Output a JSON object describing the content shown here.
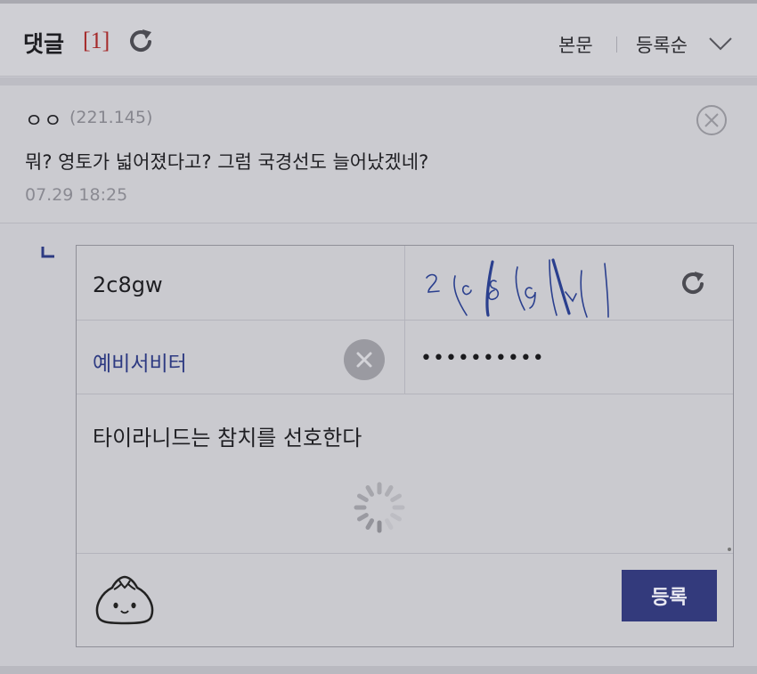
{
  "header": {
    "title": "댓글",
    "count": "[1]",
    "sort_body": "본문",
    "sort_order": "등록순"
  },
  "comment": {
    "author": "ㅇㅇ",
    "ip": "(221.145)",
    "text": "뭐? 영토가 넓어졌다고? 그럼 국경선도 늘어났겠네?",
    "time": "07.29 18:25"
  },
  "reply_form": {
    "captcha_value": "2c8gw",
    "captcha_image_text": "2c8gw",
    "nickname": "예비서비터",
    "password": "••••••••••",
    "memo": "타이라니드는 참치를 선호한다",
    "submit_label": "등록"
  },
  "colors": {
    "accent": "#333a7c",
    "count_red": "#a52a2a",
    "nickname_blue": "#2d3a82"
  }
}
